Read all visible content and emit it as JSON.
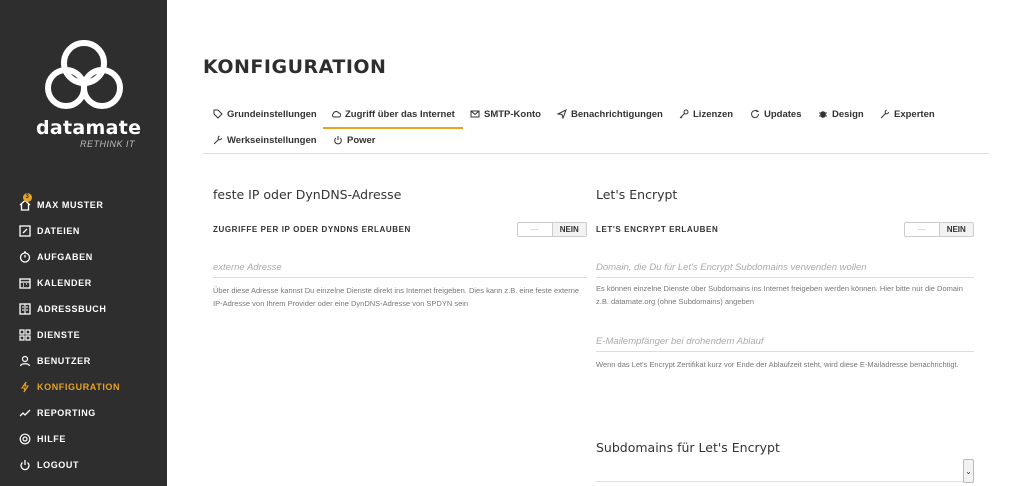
{
  "brand": {
    "name": "datamate",
    "tagline": "RETHINK IT"
  },
  "user_badge": "3",
  "nav": [
    {
      "label": "MAX MUSTER",
      "icon": "home-icon"
    },
    {
      "label": "DATEIEN",
      "icon": "edit-icon"
    },
    {
      "label": "AUFGABEN",
      "icon": "timer-icon"
    },
    {
      "label": "KALENDER",
      "icon": "calendar-icon"
    },
    {
      "label": "ADRESSBUCH",
      "icon": "addressbook-icon"
    },
    {
      "label": "DIENSTE",
      "icon": "grid-icon"
    },
    {
      "label": "BENUTZER",
      "icon": "users-icon"
    },
    {
      "label": "KONFIGURATION",
      "icon": "bolt-icon",
      "active": true
    },
    {
      "label": "REPORTING",
      "icon": "chart-icon"
    },
    {
      "label": "HILFE",
      "icon": "lifebuoy-icon"
    },
    {
      "label": "LOGOUT",
      "icon": "power-icon"
    }
  ],
  "page_title": "KONFIGURATION",
  "tabs": [
    {
      "label": "Grundeinstellungen",
      "icon": "tag-icon"
    },
    {
      "label": "Zugriff über das Internet",
      "icon": "cloud-icon",
      "active": true
    },
    {
      "label": "SMTP-Konto",
      "icon": "mail-icon"
    },
    {
      "label": "Benachrichtigungen",
      "icon": "send-icon"
    },
    {
      "label": "Lizenzen",
      "icon": "key-icon"
    },
    {
      "label": "Updates",
      "icon": "refresh-icon"
    },
    {
      "label": "Design",
      "icon": "bug-icon"
    },
    {
      "label": "Experten",
      "icon": "wrench-icon"
    },
    {
      "label": "Werkseinstellungen",
      "icon": "wrench-icon"
    },
    {
      "label": "Power",
      "icon": "power-icon"
    }
  ],
  "left": {
    "title": "feste IP oder DynDNS-Adresse",
    "option_label": "ZUGRIFFE PER IP ODER DYNDNS ERLAUBEN",
    "toggle_value": "NEIN",
    "address_placeholder": "externe Adresse",
    "help": "Über diese Adresse kannst Du einzelne Dienste direkt ins Internet freigeben. Dies kann z.B. eine feste externe IP-Adresse von Ihrem Provider oder eine DynDNS-Adresse von SPDYN sein"
  },
  "right": {
    "title": "Let's Encrypt",
    "option_label": "LET'S ENCRYPT ERLAUBEN",
    "toggle_value": "NEIN",
    "domain_placeholder": "Domain, die Du für Let's Encrypt Subdomains verwenden wollen",
    "domain_help": "Es können einzelne Dienste über Subdomains ins Internet freigeben werden können. Hier bitte nur die Domain z.B. datamate.org (ohne Subdomains) angeben",
    "email_placeholder": "E-Mailempfänger bei drohendem Ablauf",
    "email_help": "Wenn das Let's Encrypt Zertifikat kurz vor Ende der Ablaufzeit steht, wird diese E-Mailadresse benachrichtigt.",
    "subdomains_title": "Subdomains für Let's Encrypt"
  },
  "colors": {
    "sidebar": "#2e2e2e",
    "accent": "#e8a321"
  }
}
